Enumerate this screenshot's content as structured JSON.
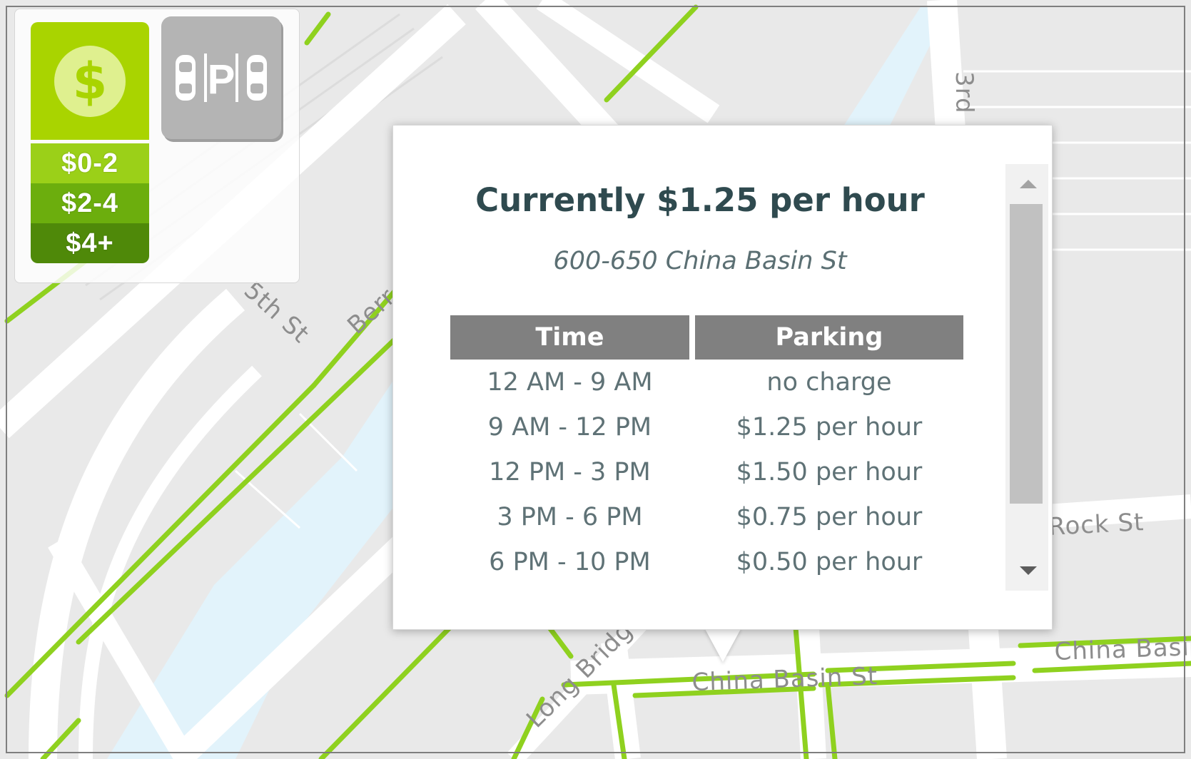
{
  "map": {
    "street_labels": {
      "fifth_st": "5th St",
      "berry_partial": "Berr",
      "third_partial": "3rd",
      "rock_partial": "Rock St",
      "china_basin_main": "China Basin St",
      "china_basin_right": "China Basi",
      "long_bridge": "Long Bridge"
    },
    "colors": {
      "parking_line": "#8fd11f",
      "water": "#e2f3fb",
      "road": "#ffffff",
      "land": "#e9e9e9"
    }
  },
  "legend": {
    "price_button_icon": "dollar-coin-icon",
    "parking_button_icon": "parking-cars-icon",
    "parking_letter": "P",
    "tiers": [
      {
        "label": "$0-2",
        "color": "#9bd018"
      },
      {
        "label": "$2-4",
        "color": "#6cae0d"
      },
      {
        "label": "$4+",
        "color": "#4f8909"
      }
    ]
  },
  "popup": {
    "title": "Currently $1.25 per hour",
    "address": "600-650 China Basin St",
    "table": {
      "headers": [
        "Time",
        "Parking"
      ],
      "rows": [
        [
          "12 AM - 9 AM",
          "no charge"
        ],
        [
          "9 AM - 12 PM",
          "$1.25 per hour"
        ],
        [
          "12 PM - 3 PM",
          "$1.50 per hour"
        ],
        [
          "3 PM - 6 PM",
          "$0.75 per hour"
        ],
        [
          "6 PM - 10 PM",
          "$0.50 per hour"
        ]
      ]
    }
  }
}
